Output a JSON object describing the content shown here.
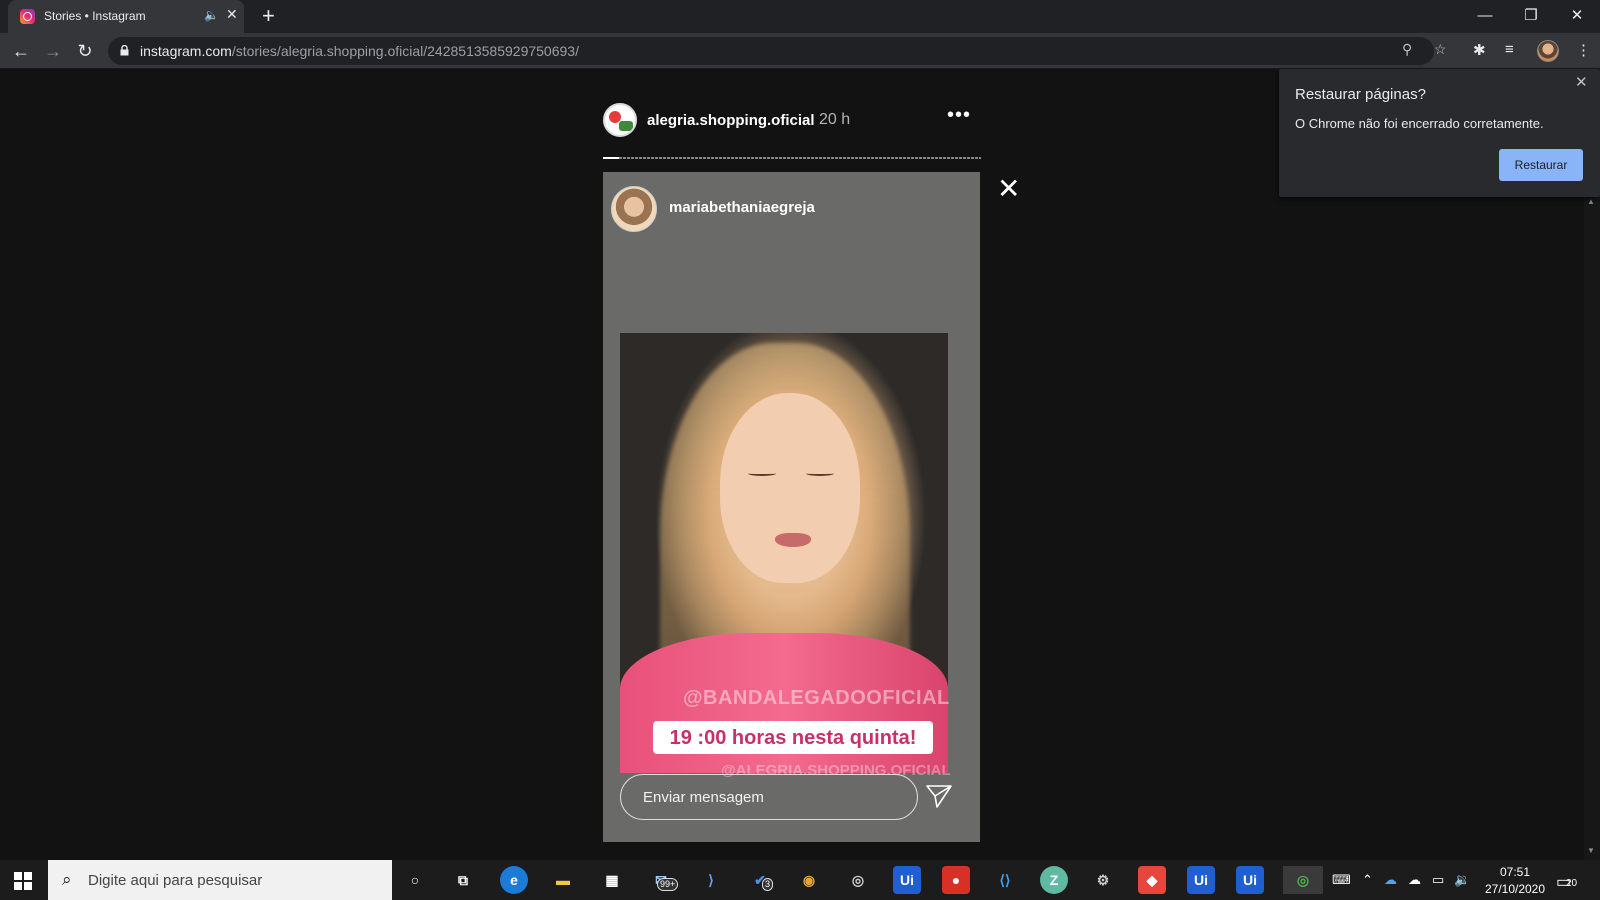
{
  "browser": {
    "tab": {
      "title": "Stories • Instagram",
      "audio_icon": "speaker-icon",
      "close_glyph": "✕"
    },
    "new_tab_glyph": "+",
    "window_controls": {
      "minimize": "—",
      "restore": "❐",
      "close": "✕"
    },
    "url_host": "instagram.com",
    "url_path": "/stories/alegria.shopping.oficial/2428513585929750693/"
  },
  "story": {
    "owner_username": "alegria.shopping.oficial",
    "time_ago": "20 h",
    "more_glyph": "•••",
    "progress_fraction": 0.04,
    "author_username": "mariabethaniaegreja",
    "sticker_mention": "@BANDALEGADOOFICIAL",
    "sticker_time": "19 :00 horas nesta quinta!",
    "sticker_shop": "@ALEGRIA.SHOPPING.OFICIAL",
    "message_placeholder": "Enviar mensagem",
    "close_glyph": "✕"
  },
  "restore_popup": {
    "title": "Restaurar páginas?",
    "message": "O Chrome não foi encerrado corretamente.",
    "button": "Restaurar",
    "close_glyph": "✕"
  },
  "taskbar": {
    "search_placeholder": "Digite aqui para pesquisar",
    "apps": [
      {
        "name": "cortana",
        "label": "○"
      },
      {
        "name": "task-view",
        "label": "⧉"
      },
      {
        "name": "edge",
        "label": "e"
      },
      {
        "name": "file-explorer",
        "label": "▬"
      },
      {
        "name": "store",
        "label": "▦"
      },
      {
        "name": "mail",
        "label": "✉",
        "badge": "99+"
      },
      {
        "name": "azure-devops",
        "label": "⟩"
      },
      {
        "name": "todo",
        "label": "✔",
        "badge": "3"
      },
      {
        "name": "chrome-canary",
        "label": "◉"
      },
      {
        "name": "obs",
        "label": "◎"
      },
      {
        "name": "uipath-studio",
        "label": "Ui"
      },
      {
        "name": "recorder",
        "label": "●"
      },
      {
        "name": "vscode",
        "label": "⟨⟩"
      },
      {
        "name": "zoom-app",
        "label": "Z"
      },
      {
        "name": "settings-app",
        "label": "⚙"
      },
      {
        "name": "anydesk",
        "label": "◆"
      },
      {
        "name": "uipath-robot",
        "label": "Ui"
      },
      {
        "name": "uipath-assistant",
        "label": "Ui"
      },
      {
        "name": "chrome",
        "label": "◎"
      }
    ],
    "clock_time": "07:51",
    "clock_date": "27/10/2020",
    "notification_count": "20"
  }
}
